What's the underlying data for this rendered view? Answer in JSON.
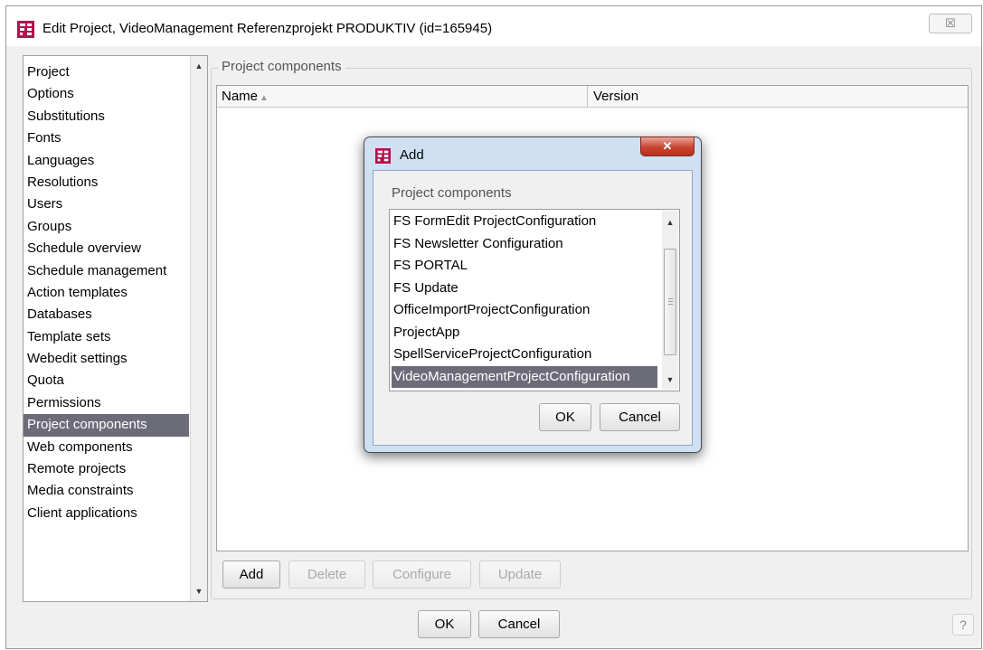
{
  "window": {
    "title": "Edit Project, VideoManagement Referenzprojekt PRODUKTIV (id=165945)",
    "close_glyph": "☒",
    "app_icon": "firstspirit-logo-icon"
  },
  "sidebar": {
    "items": [
      {
        "label": "Project"
      },
      {
        "label": "Options"
      },
      {
        "label": "Substitutions"
      },
      {
        "label": "Fonts"
      },
      {
        "label": "Languages"
      },
      {
        "label": "Resolutions"
      },
      {
        "label": "Users"
      },
      {
        "label": "Groups"
      },
      {
        "label": "Schedule overview"
      },
      {
        "label": "Schedule management"
      },
      {
        "label": "Action templates"
      },
      {
        "label": "Databases"
      },
      {
        "label": "Template sets"
      },
      {
        "label": "Webedit settings"
      },
      {
        "label": "Quota"
      },
      {
        "label": "Permissions"
      },
      {
        "label": "Project components",
        "selected": true
      },
      {
        "label": "Web components"
      },
      {
        "label": "Remote projects"
      },
      {
        "label": "Media constraints"
      },
      {
        "label": "Client applications"
      }
    ]
  },
  "main": {
    "group_label": "Project components",
    "table": {
      "columns": [
        "Name",
        "Version"
      ],
      "sort_glyph": "▲",
      "rows": []
    },
    "buttons": {
      "add": "Add",
      "delete": "Delete",
      "configure": "Configure",
      "update": "Update"
    }
  },
  "footer": {
    "ok": "OK",
    "cancel": "Cancel",
    "help": "?"
  },
  "dialog": {
    "title": "Add",
    "close_glyph": "✕",
    "group_label": "Project components",
    "items": [
      "FS FormEdit ProjectConfiguration",
      "FS Newsletter Configuration",
      "FS PORTAL",
      "FS Update",
      "OfficeImportProjectConfiguration",
      "ProjectApp",
      "SpellServiceProjectConfiguration",
      "VideoManagementProjectConfiguration"
    ],
    "selected_index": 7,
    "ok": "OK",
    "cancel": "Cancel"
  },
  "colors": {
    "selection": "#6c6c79",
    "logo": "#b3124f",
    "dialog_frame": "#cfe0f3",
    "close_red": "#c8432f"
  }
}
